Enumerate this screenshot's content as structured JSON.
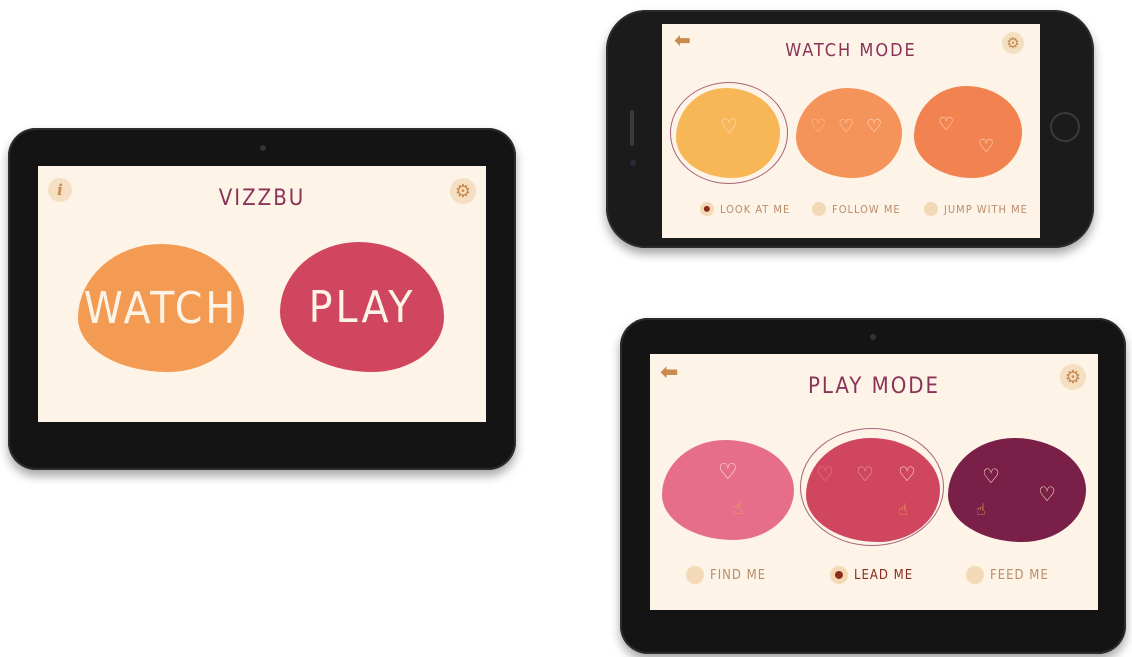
{
  "tablet_home": {
    "title": "VIZZBU",
    "info_icon": "i",
    "watch_label": "WATCH",
    "play_label": "PLAY"
  },
  "phone_watch": {
    "title": "WATCH MODE",
    "options": [
      {
        "label": "LOOK AT ME",
        "selected": true
      },
      {
        "label": "FOLLOW ME",
        "selected": false
      },
      {
        "label": "JUMP WITH ME",
        "selected": false
      }
    ]
  },
  "tablet_play": {
    "title": "PLAY MODE",
    "options": [
      {
        "label": "FIND ME",
        "selected": false
      },
      {
        "label": "LEAD ME",
        "selected": true
      },
      {
        "label": "FEED ME",
        "selected": false
      }
    ]
  },
  "colors": {
    "background_screen": "#fdf3e6",
    "watch_orange": "#f39a53",
    "play_red": "#d1465f",
    "look_yellow": "#f7b757",
    "follow_orange": "#f5945a",
    "jump_orange": "#f2824f",
    "find_pink": "#e76e8a",
    "lead_red": "#d1465f",
    "feed_plum": "#7a2048",
    "title_purple": "#8a3358"
  },
  "icons": {
    "gear": "gear-icon",
    "back": "back-arrow-icon",
    "info": "info-icon",
    "bunny": "bunny-icon",
    "finger": "pointing-finger-icon"
  }
}
